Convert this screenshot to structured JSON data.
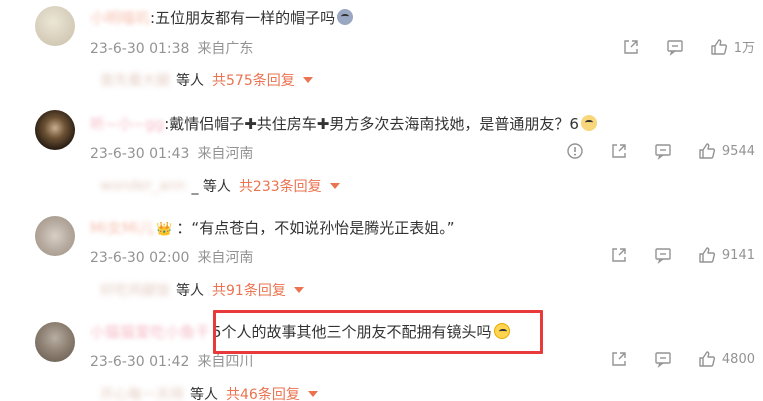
{
  "comments": [
    {
      "username": "小明喵叽",
      "text": ":五位朋友都有一样的帽子吗",
      "emoji": "sad-face-emoji",
      "timestamp": "23-6-30 01:38",
      "location": "来自广东",
      "likes": "1万",
      "replies": {
        "names": "首先看大腿",
        "suffix": "等人",
        "total": "共575条回复"
      }
    },
    {
      "username": "听~小~gg",
      "text": ":戴情侣帽子✚共住房车✚男方多次去海南找她，是普通朋友？6",
      "emoji": "cat-emoji",
      "timestamp": "23-6-30 01:43",
      "location": "来自河南",
      "likes": "9544",
      "replies": {
        "names": "wonder_ann",
        "suffix": "_ 等人",
        "total": "共233条回复"
      }
    },
    {
      "username": "Mi女Mi儿",
      "text": "：“有点苍白，不如说孙怡是腾光正表姐。”",
      "emoji": "",
      "timestamp": "23-6-30 02:00",
      "location": "来自河南",
      "likes": "9141",
      "replies": {
        "names": "好吃鸡腿饭",
        "suffix": "等人",
        "total": "共91条回复"
      }
    },
    {
      "username": "小猫猫爱吃小鱼干",
      "text": "5个人的故事其他三个朋友不配拥有镜头吗",
      "emoji": "sweat-emoji",
      "timestamp": "23-6-30 01:42",
      "location": "来自四川",
      "likes": "4800",
      "replies": {
        "names": "开心每一天呀",
        "suffix": "等人",
        "total": "共46条回复"
      }
    }
  ],
  "colors": {
    "accent": "#eb7350",
    "meta_gray": "#939393",
    "highlight_border": "#e83a3a"
  }
}
